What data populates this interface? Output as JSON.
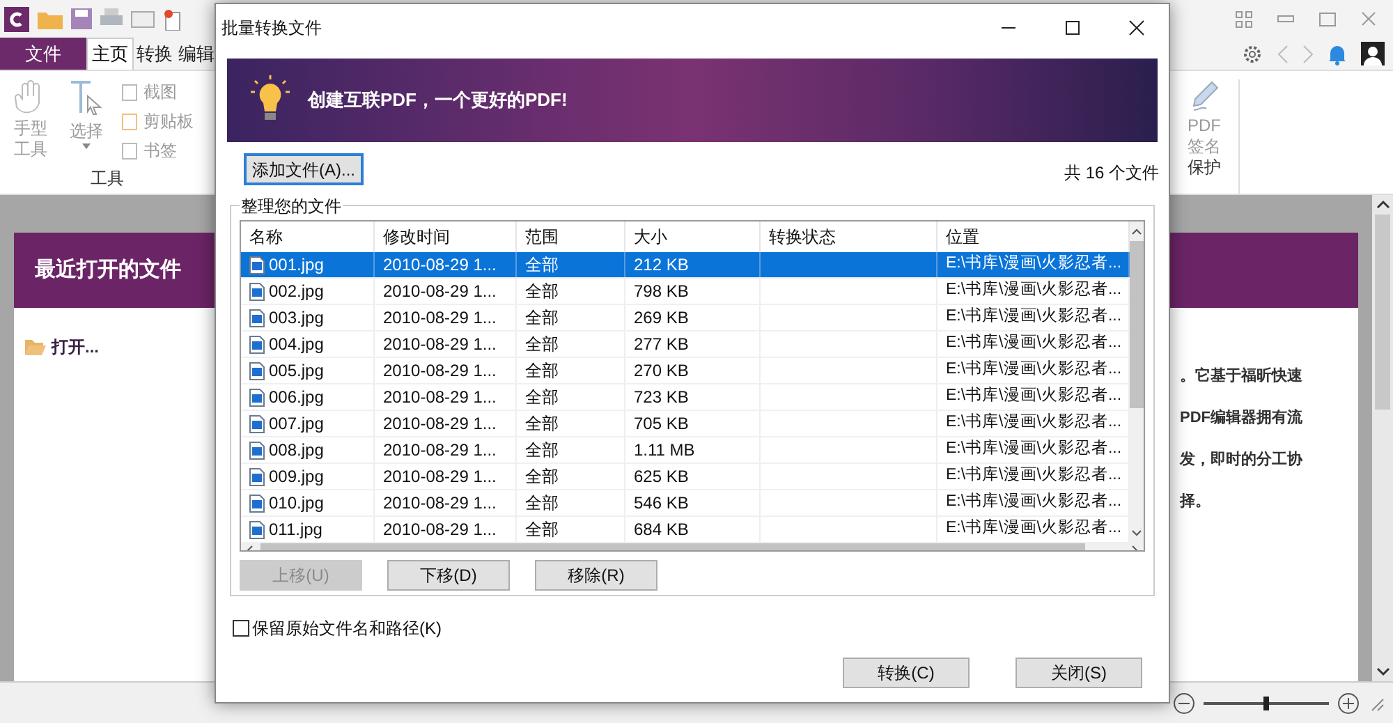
{
  "app": {
    "menu_tabs": [
      {
        "label": "文件",
        "kind": "file",
        "selected": false
      },
      {
        "label": "主页",
        "kind": "tab",
        "selected": true
      },
      {
        "label": "转换",
        "kind": "tab",
        "selected": false
      },
      {
        "label": "编辑",
        "kind": "tab",
        "selected": false
      }
    ],
    "ribbon": {
      "hand_tool": "手型工具",
      "select_tool": "选择",
      "small_tools": [
        "截图",
        "剪贴板",
        "书签"
      ],
      "group_label": "工具",
      "sign_button": "PDF签名",
      "sign_group": "保护"
    },
    "start_page": {
      "title": "最近打开的文件",
      "open_link": "打开...",
      "text_lines": [
        "。它基于福昕快速",
        "PDF编辑器拥有流",
        "发，即时的分工协",
        "择。"
      ]
    },
    "zoom_slider": {
      "level": 0.5
    }
  },
  "dialog": {
    "title": "批量转换文件",
    "banner": "创建互联PDF，一个更好的PDF!",
    "add_button": "添加文件(A)...",
    "file_count": "共 16 个文件",
    "group_label": "整理您的文件",
    "table": {
      "columns": [
        "名称",
        "修改时间",
        "范围",
        "大小",
        "转换状态",
        "位置"
      ],
      "rows": [
        {
          "name": "001.jpg",
          "modified": "2010-08-29 1...",
          "range": "全部",
          "size": "212 KB",
          "location": "E:\\书库\\漫画\\火影忍者...",
          "selected": true
        },
        {
          "name": "002.jpg",
          "modified": "2010-08-29 1...",
          "range": "全部",
          "size": "798 KB",
          "location": "E:\\书库\\漫画\\火影忍者...",
          "selected": false
        },
        {
          "name": "003.jpg",
          "modified": "2010-08-29 1...",
          "range": "全部",
          "size": "269 KB",
          "location": "E:\\书库\\漫画\\火影忍者...",
          "selected": false
        },
        {
          "name": "004.jpg",
          "modified": "2010-08-29 1...",
          "range": "全部",
          "size": "277 KB",
          "location": "E:\\书库\\漫画\\火影忍者...",
          "selected": false
        },
        {
          "name": "005.jpg",
          "modified": "2010-08-29 1...",
          "range": "全部",
          "size": "270 KB",
          "location": "E:\\书库\\漫画\\火影忍者...",
          "selected": false
        },
        {
          "name": "006.jpg",
          "modified": "2010-08-29 1...",
          "range": "全部",
          "size": "723 KB",
          "location": "E:\\书库\\漫画\\火影忍者...",
          "selected": false
        },
        {
          "name": "007.jpg",
          "modified": "2010-08-29 1...",
          "range": "全部",
          "size": "705 KB",
          "location": "E:\\书库\\漫画\\火影忍者...",
          "selected": false
        },
        {
          "name": "008.jpg",
          "modified": "2010-08-29 1...",
          "range": "全部",
          "size": "1.11 MB",
          "location": "E:\\书库\\漫画\\火影忍者...",
          "selected": false
        },
        {
          "name": "009.jpg",
          "modified": "2010-08-29 1...",
          "range": "全部",
          "size": "625 KB",
          "location": "E:\\书库\\漫画\\火影忍者...",
          "selected": false
        },
        {
          "name": "010.jpg",
          "modified": "2010-08-29 1...",
          "range": "全部",
          "size": "546 KB",
          "location": "E:\\书库\\漫画\\火影忍者...",
          "selected": false
        },
        {
          "name": "011.jpg",
          "modified": "2010-08-29 1...",
          "range": "全部",
          "size": "684 KB",
          "location": "E:\\书库\\漫画\\火影忍者...",
          "selected": false
        }
      ]
    },
    "list_buttons": [
      {
        "label": "上移(U)",
        "disabled": true
      },
      {
        "label": "下移(D)",
        "disabled": false
      },
      {
        "label": "移除(R)",
        "disabled": false
      }
    ],
    "checkbox": {
      "label": "保留原始文件名和路径(K)",
      "checked": false
    },
    "footer_buttons": [
      "转换(C)",
      "关闭(S)"
    ]
  }
}
